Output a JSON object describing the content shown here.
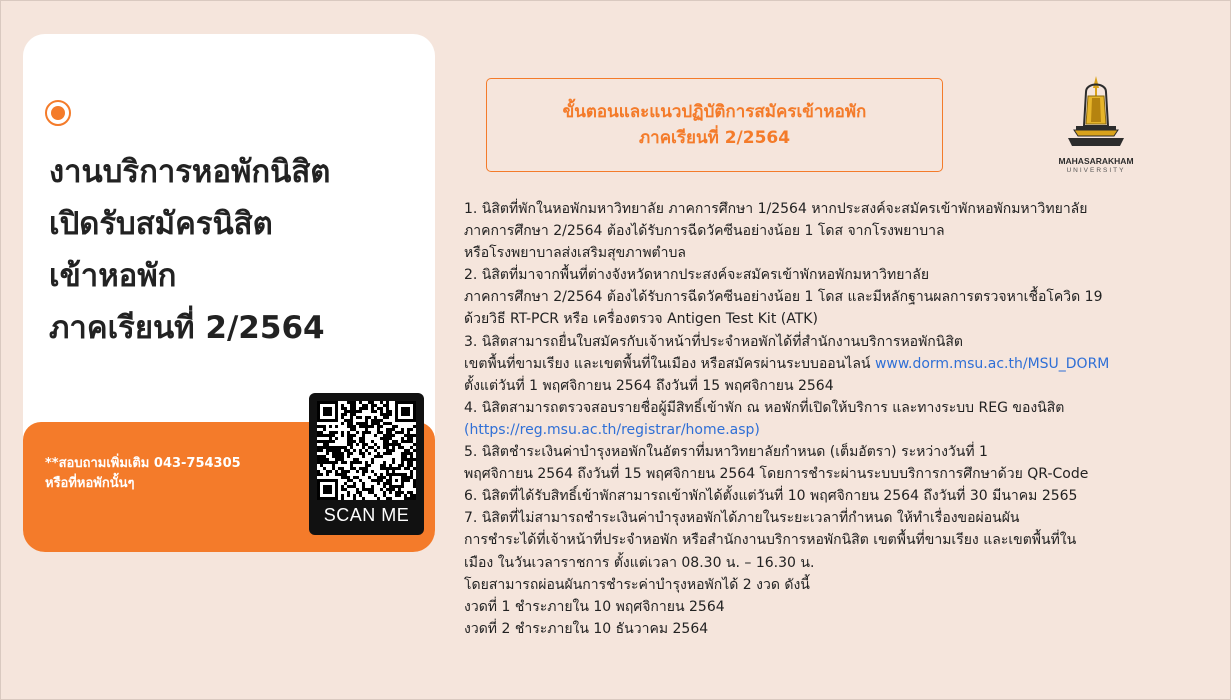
{
  "headline": {
    "line1": "งานบริการหอพักนิสิต",
    "line2": "เปิดรับสมัครนิสิต",
    "line3": "เข้าหอพัก",
    "line4": "ภาคเรียนที่  2/2564"
  },
  "contact": {
    "line1": "**สอบถามเพิ่มเติม  043-754305",
    "line2": "หรือที่หอพักนั้นๆ"
  },
  "qr": {
    "label": "SCAN ME"
  },
  "title": {
    "line1": "ขั้นตอนและแนวปฏิบัติการสมัครเข้าหอพัก",
    "line2": "ภาคเรียนที่  2/2564"
  },
  "logo": {
    "name": "MAHASARAKHAM",
    "sub": "UNIVERSITY"
  },
  "body": {
    "l1": "1.  นิสิตที่พักในหอพักมหาวิทยาลัย ภาคการศึกษา 1/2564  หากประสงค์จะสมัครเข้าพักหอพักมหาวิทยาลัย",
    "l2": "ภาคการศึกษา 2/2564 ต้องได้รับการฉีดวัคซีนอย่างน้อย 1 โดส จากโรงพยาบาล",
    "l3": "หรือโรงพยาบาลส่งเสริมสุขภาพตำบล",
    "l4": "2.  นิสิตที่มาจากพื้นที่ต่างจังหวัดหากประสงค์จะสมัครเข้าพักหอพักมหาวิทยาลัย",
    "l5": "ภาคการศึกษา 2/2564 ต้องได้รับการฉีดวัคซีนอย่างน้อย 1 โดส และมีหลักฐานผลการตรวจหาเชื้อโควิด 19",
    "l6": "ด้วยวิธี RT-PCR หรือ เครื่องตรวจ Antigen Test Kit (ATK)",
    "l7": "3.  นิสิตสามารถยื่นใบสมัครกับเจ้าหน้าที่ประจำหอพักได้ที่สำนักงานบริการหอพักนิสิต",
    "l8": "เขตพื้นที่ขามเรียง และเขตพื้นที่ในเมือง หรือสมัครผ่านระบบออนไลน์ ",
    "l8_link": "www.dorm.msu.ac.th/MSU_DORM",
    "l9": "ตั้งแต่วันที่ 1 พฤศจิกายน 2564 ถึงวันที่ 15 พฤศจิกายน 2564",
    "l10": "4.  นิสิตสามารถตรวจสอบรายชื่อผู้มีสิทธิ์เข้าพัก ณ หอพักที่เปิดให้บริการ และทางระบบ REG ของนิสิต",
    "l11_link": "(https://reg.msu.ac.th/registrar/home.asp)",
    "l12": "5.  นิสิตชำระเงินค่าบำรุงหอพักในอัตราที่มหาวิทยาลัยกำหนด (เต็มอัตรา) ระหว่างวันที่  1",
    "l13": "พฤศจิกายน 2564  ถึงวันที่ 15 พฤศจิกายน 2564  โดยการชำระผ่านระบบบริการการศึกษาด้วย QR-Code",
    "l14": "6.  นิสิตที่ได้รับสิทธิ์เข้าพักสามารถเข้าพักได้ตั้งแต่วันที่ 10 พฤศจิกายน 2564 ถึงวันที่ 30 มีนาคม 2565",
    "l15": "7.  นิสิตที่ไม่สามารถชำระเงินค่าบำรุงหอพักได้ภายในระยะเวลาที่กำหนด ให้ทำเรื่องขอผ่อนผัน",
    "l16": "การชำระได้ที่เจ้าหน้าที่ประจำหอพัก หรือสำนักงานบริการหอพักนิสิต เขตพื้นที่ขามเรียง และเขตพื้นที่ใน",
    "l17": "เมือง ในวันเวลาราชการ ตั้งแต่เวลา 08.30 น. – 16.30 น.",
    "l18": "โดยสามารถผ่อนผันการชำระค่าบำรุงหอพักได้ 2 งวด ดังนี้",
    "l19": "งวดที่ 1  ชำระภายใน 10 พฤศจิกายน 2564",
    "l20": "งวดที่ 2  ชำระภายใน  10 ธันวาคม 2564"
  },
  "colors": {
    "accent": "#f47b2a",
    "background": "#f5e5dc",
    "link": "#2f6fd6"
  }
}
